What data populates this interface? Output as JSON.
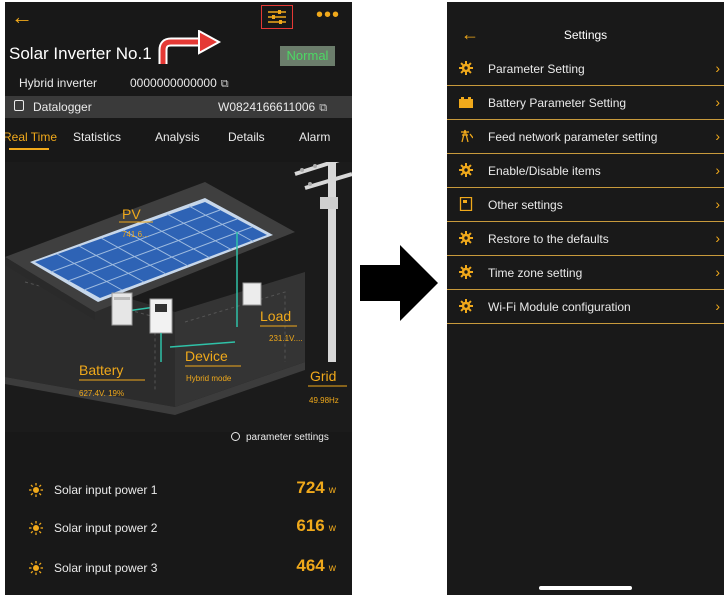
{
  "left_screen": {
    "header": {
      "back_icon": "back-arrow-icon",
      "filter_icon": "sliders-icon",
      "more_icon": "more-dots-icon",
      "title": "Solar Inverter No.1",
      "status_badge": "Normal"
    },
    "device_info": {
      "type_label": "Hybrid inverter",
      "serial": "0000000000000",
      "datalogger_label": "Datalogger",
      "datalogger_serial": "W0824166611006"
    },
    "tabs": [
      {
        "label": "Real Time",
        "active": true
      },
      {
        "label": "Statistics",
        "active": false
      },
      {
        "label": "Analysis",
        "active": false
      },
      {
        "label": "Details",
        "active": false
      },
      {
        "label": "Alarm",
        "active": false
      }
    ],
    "diagram": {
      "pv_label": "PV",
      "pv_value": "741.6...",
      "load_label": "Load",
      "load_value": "231.1V....",
      "device_label": "Device",
      "device_value": "Hybrid mode",
      "battery_label": "Battery",
      "battery_value": "627.4V. 19%",
      "grid_label": "Grid",
      "grid_value": "49.98Hz"
    },
    "parameter_link": "parameter settings",
    "power_rows": [
      {
        "label": "Solar input power 1",
        "value": "724",
        "unit": "w"
      },
      {
        "label": "Solar input power 2",
        "value": "616",
        "unit": "w"
      },
      {
        "label": "Solar input power 3",
        "value": "464",
        "unit": "w"
      }
    ]
  },
  "right_screen": {
    "title": "Settings",
    "items": [
      {
        "label": "Parameter Setting",
        "icon": "gear-icon"
      },
      {
        "label": "Battery Parameter Setting",
        "icon": "battery-icon"
      },
      {
        "label": "Feed network parameter setting",
        "icon": "grid-tower-icon"
      },
      {
        "label": "Enable/Disable items",
        "icon": "gear-icon"
      },
      {
        "label": "Other settings",
        "icon": "document-icon"
      },
      {
        "label": "Restore to the defaults",
        "icon": "gear-icon"
      },
      {
        "label": "Time zone setting",
        "icon": "gear-icon"
      },
      {
        "label": "Wi-Fi Module configuration",
        "icon": "gear-icon"
      }
    ]
  },
  "colors": {
    "accent": "#f0a91b",
    "background": "#181818",
    "status_green": "#4cd964",
    "highlight_red": "#e53935"
  }
}
